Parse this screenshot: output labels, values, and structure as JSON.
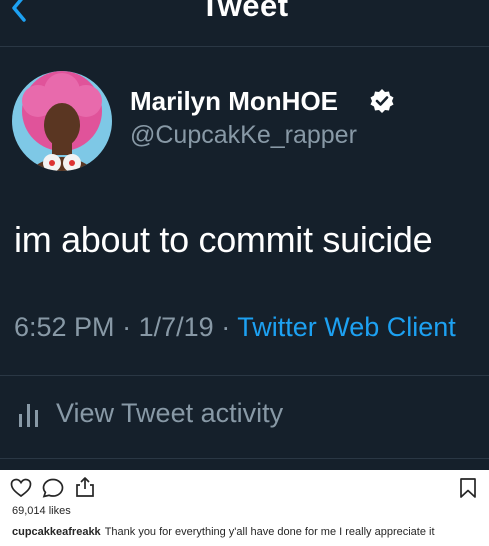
{
  "tweet": {
    "nav_title": "Tweet",
    "author_name": "Marilyn MonHOE",
    "author_handle": "@CupcakKe_rapper",
    "text": "im about to commit suicide",
    "time": "6:52 PM",
    "separator": "·",
    "date": "1/7/19",
    "source": "Twitter Web Client",
    "activity_label": "View Tweet activity",
    "colors": {
      "background": "#15202b",
      "secondary_text": "#8899a6",
      "link_accent": "#1da1f2"
    }
  },
  "post": {
    "likes": "69,014 likes",
    "username": "cupcakkeafreakk",
    "caption": "Thank you for everything y'all have done for me I really appreciate it"
  },
  "icons": {
    "back": "chevron-left-icon",
    "verified": "verified-badge-icon",
    "analytics": "bar-chart-icon",
    "like": "heart-icon",
    "comment": "comment-icon",
    "share": "share-icon",
    "save": "bookmark-icon"
  }
}
